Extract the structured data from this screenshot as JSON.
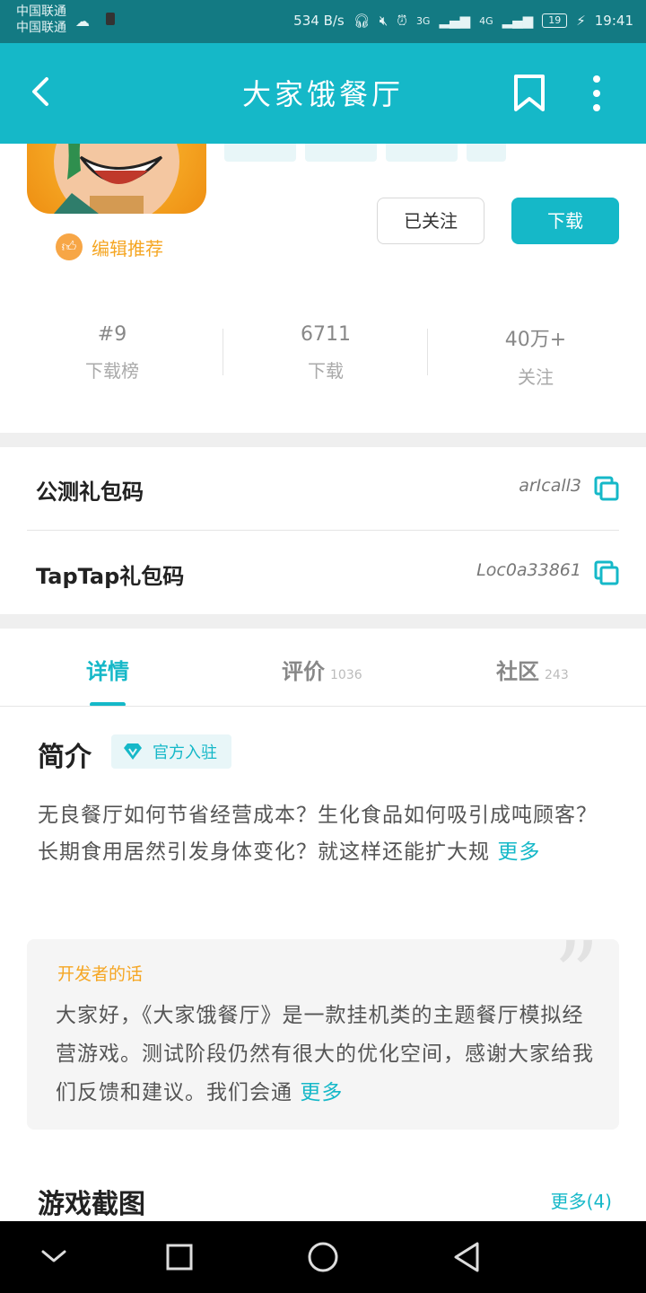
{
  "status_bar": {
    "carrier_1": "中国联通",
    "carrier_2": "中国联通",
    "speed": "534 B/s",
    "network_1": "3G",
    "network_2": "4G",
    "battery": "19",
    "time": "19:41"
  },
  "header": {
    "title": "大家饿餐厅"
  },
  "app": {
    "editor_pick": "编辑推荐",
    "followed_button": "已关注",
    "download_button": "下载"
  },
  "stats": [
    {
      "value": "#9",
      "label": "下载榜"
    },
    {
      "value": "6711",
      "label": "下载"
    },
    {
      "value": "40万+",
      "label": "关注"
    }
  ],
  "gift_codes": [
    {
      "label": "公测礼包码",
      "code": "arIcall3"
    },
    {
      "label": "TapTap礼包码",
      "code": "Loc0a33861"
    }
  ],
  "tabs": [
    {
      "label": "详情",
      "count": ""
    },
    {
      "label": "评价",
      "count": "1036"
    },
    {
      "label": "社区",
      "count": "243"
    }
  ],
  "intro": {
    "title": "简介",
    "badge": "官方入驻",
    "line1": "无良餐厅如何节省经营成本？生化食品如何吸引成吨顾客？",
    "line2": "长期食用居然引发身体变化？就这样还能扩大规",
    "more": "更多"
  },
  "developer": {
    "title": "开发者的话",
    "text": "大家好，《大家饿餐厅》是一款挂机类的主题餐厅模拟经营游戏。测试阶段仍然有很大的优化空间，感谢大家给我们反馈和建议。我们会通",
    "more": "更多"
  },
  "screenshots": {
    "title": "游戏截图",
    "more": "更多(4)"
  },
  "icons": {
    "back": "back-arrow-icon",
    "bookmark": "bookmark-icon",
    "menu": "more-vertical-icon",
    "copy": "copy-icon",
    "diamond": "diamond-icon",
    "thumb": "thumbs-up-icon"
  },
  "colors": {
    "accent": "#15b8c8",
    "status_bar": "#137a83",
    "orange": "#f5a623"
  }
}
